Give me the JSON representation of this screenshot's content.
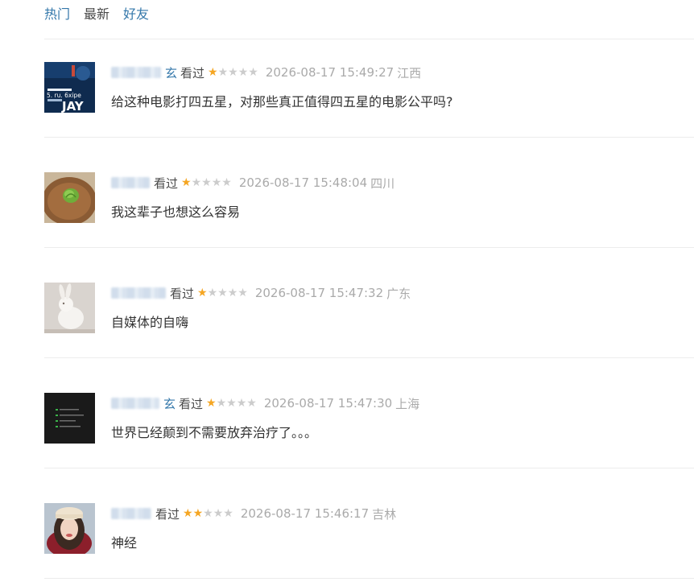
{
  "tabs": [
    {
      "label": "热门",
      "state": "active"
    },
    {
      "label": "最新",
      "state": "inactive"
    },
    {
      "label": "好友",
      "state": "link"
    }
  ],
  "comments": [
    {
      "user_tail": "玄",
      "watched": "看过",
      "rating": 1,
      "max_rating": 5,
      "time": "2026-08-17 15:49:27",
      "location": "江西",
      "text": "给这种电影打四五星，对那些真正值得四五星的电影公平吗?",
      "avatar_caption_top": "5. ru. 6xipe",
      "avatar_caption_bottom": "JAY"
    },
    {
      "user_tail": "",
      "watched": "看过",
      "rating": 1,
      "max_rating": 5,
      "time": "2026-08-17 15:48:04",
      "location": "四川",
      "text": "我这辈子也想这么容易"
    },
    {
      "user_tail": "",
      "watched": "看过",
      "rating": 1,
      "max_rating": 5,
      "time": "2026-08-17 15:47:32",
      "location": "广东",
      "text": "自媒体的自嗨"
    },
    {
      "user_tail": "玄",
      "watched": "看过",
      "rating": 1,
      "max_rating": 5,
      "time": "2026-08-17 15:47:30",
      "location": "上海",
      "text": "世界已经颠到不需要放弃治疗了。。。"
    },
    {
      "user_tail": "",
      "watched": "看过",
      "rating": 2,
      "max_rating": 5,
      "time": "2026-08-17 15:46:17",
      "location": "吉林",
      "text": "神经"
    }
  ],
  "colors": {
    "accent": "#3377aa",
    "star_on": "#f5a623",
    "star_off": "#cccccc",
    "meta": "#aaaaaa"
  }
}
